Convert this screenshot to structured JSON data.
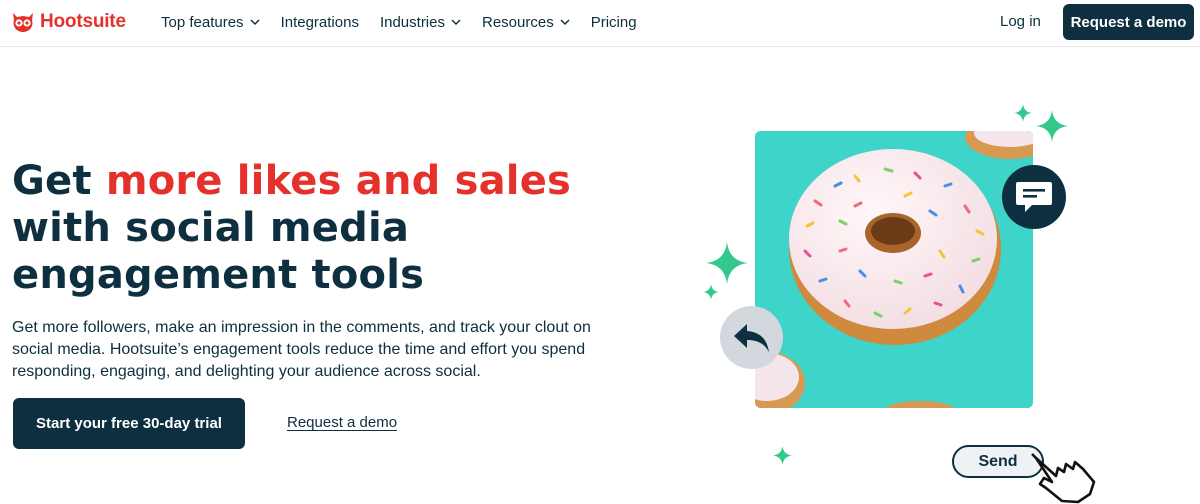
{
  "header": {
    "logo_text": "Hootsuite",
    "nav": [
      {
        "label": "Top features",
        "has_dropdown": true
      },
      {
        "label": "Integrations",
        "has_dropdown": false
      },
      {
        "label": "Industries",
        "has_dropdown": true
      },
      {
        "label": "Resources",
        "has_dropdown": true
      },
      {
        "label": "Pricing",
        "has_dropdown": false
      }
    ],
    "login_label": "Log in",
    "demo_button_label": "Request a demo"
  },
  "hero": {
    "headline_prefix": "Get ",
    "headline_accent": "more likes and sales",
    "headline_rest": " with social media engagement tools",
    "description": "Get more followers, make an impression in the comments, and track your clout on social media. Hootsuite’s engagement tools reduce the time and effort you spend responding, engaging, and delighting your audience across social.",
    "primary_button_label": "Start your free 30-day trial",
    "secondary_link_label": "Request a demo"
  },
  "illustration": {
    "send_label": "Send",
    "icons": [
      "comment-bubble-icon",
      "reply-arrow-icon",
      "pointer-hand-icon",
      "sparkle-icon",
      "donut-image"
    ]
  },
  "colors": {
    "brand_red": "#e5312b",
    "navy": "#0d2f3f",
    "teal": "#3fd4c9",
    "sparkle_green": "#33c98a"
  }
}
